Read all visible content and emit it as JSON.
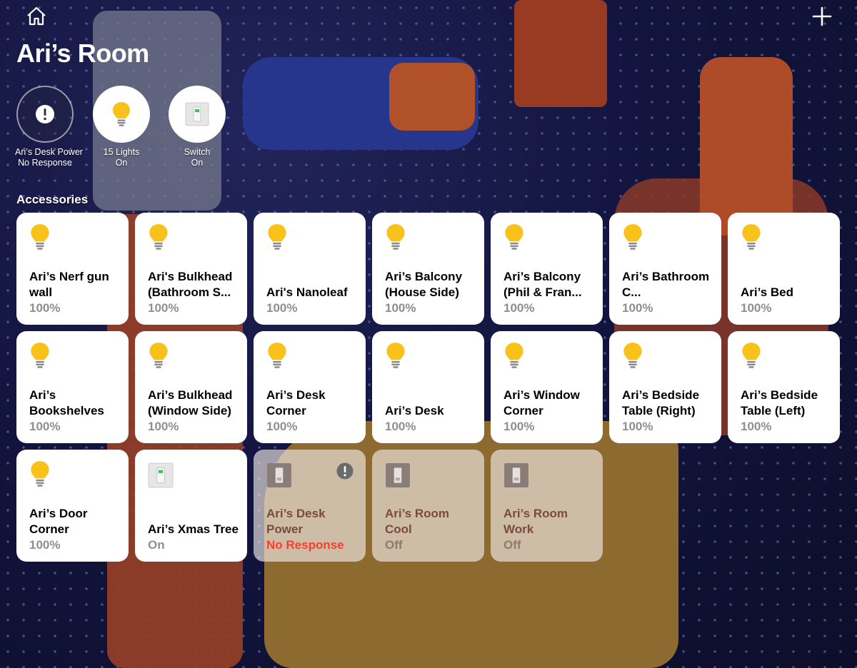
{
  "room": {
    "title": "Ari’s Room"
  },
  "toolbar": {
    "home_icon": "home-icon",
    "add_icon": "plus-icon"
  },
  "status_buttons": [
    {
      "name": "Ari’s Desk Power",
      "state": "No Response",
      "icon": "alert-icon"
    },
    {
      "name": "15 Lights",
      "state": "On",
      "icon": "lightbulb-icon"
    },
    {
      "name": "Switch",
      "state": "On",
      "icon": "switch-icon"
    }
  ],
  "section": {
    "label": "Accessories"
  },
  "accessories": [
    {
      "name": "Ari’s Nerf gun wall",
      "state": "100%",
      "icon": "lightbulb-icon"
    },
    {
      "name": "Ari's Bulkhead (Bathroom S...",
      "state": "100%",
      "icon": "lightbulb-icon"
    },
    {
      "name": "Ari's Nanoleaf",
      "state": "100%",
      "icon": "lightbulb-icon"
    },
    {
      "name": "Ari’s Balcony (House Side)",
      "state": "100%",
      "icon": "lightbulb-icon"
    },
    {
      "name": "Ari’s Balcony (Phil & Fran...",
      "state": "100%",
      "icon": "lightbulb-icon"
    },
    {
      "name": "Ari’s Bathroom C...",
      "state": "100%",
      "icon": "lightbulb-icon"
    },
    {
      "name": "Ari’s Bed",
      "state": "100%",
      "icon": "lightbulb-icon"
    },
    {
      "name": "Ari’s Bookshelves",
      "state": "100%",
      "icon": "lightbulb-icon"
    },
    {
      "name": "Ari’s Bulkhead (Window Side)",
      "state": "100%",
      "icon": "lightbulb-icon"
    },
    {
      "name": "Ari’s Desk Corner",
      "state": "100%",
      "icon": "lightbulb-icon"
    },
    {
      "name": "Ari’s Desk",
      "state": "100%",
      "icon": "lightbulb-icon"
    },
    {
      "name": "Ari’s Window Corner",
      "state": "100%",
      "icon": "lightbulb-icon"
    },
    {
      "name": "Ari’s Bedside Table (Right)",
      "state": "100%",
      "icon": "lightbulb-icon"
    },
    {
      "name": "Ari’s Bedside Table (Left)",
      "state": "100%",
      "icon": "lightbulb-icon"
    },
    {
      "name": "Ari’s Door Corner",
      "state": "100%",
      "icon": "lightbulb-icon"
    },
    {
      "name": "Ari’s Xmas Tree",
      "state": "On",
      "icon": "switch-on-icon"
    },
    {
      "name": "Ari’s Desk Power",
      "state": "No Response",
      "icon": "switch-off-icon",
      "alert": true
    },
    {
      "name": "Ari’s Room Cool",
      "state": "Off",
      "icon": "switch-off-icon"
    },
    {
      "name": "Ari’s Room Work",
      "state": "Off",
      "icon": "switch-off-icon"
    }
  ],
  "colors": {
    "bulb": "#f9c21a",
    "error": "#ff3b30",
    "tile_on": "#ffffff",
    "switch_led": "#34c759"
  }
}
